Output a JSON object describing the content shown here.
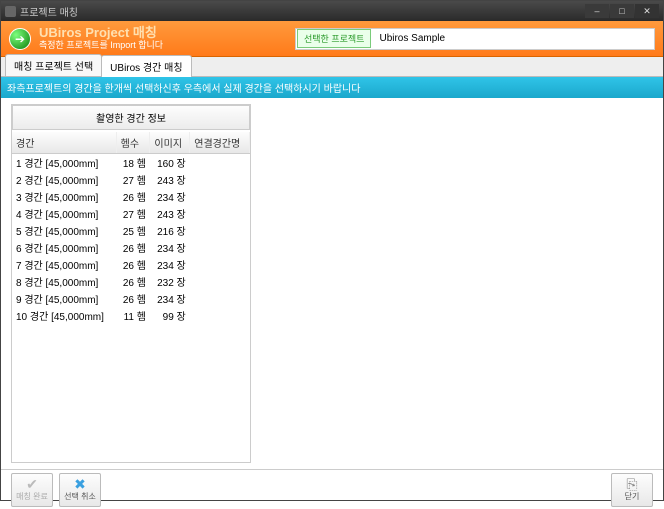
{
  "window": {
    "title": "프로젝트 매칭"
  },
  "banner": {
    "title": "UBiros Project 매칭",
    "subtitle": "측정한 프로젝트를 Import 합니다"
  },
  "project": {
    "label": "선택한 프로젝트",
    "value": "Ubiros Sample"
  },
  "tabs": [
    {
      "label": "매칭 프로젝트 선택",
      "active": false
    },
    {
      "label": "UBiros 경간 매칭",
      "active": true
    }
  ],
  "infobar": "좌측프로젝트의 경간을 한개씩 선택하신후 우측에서 실제 경간을 선택하시기 바랍니다",
  "left": {
    "header": "촬영한 경간 정보",
    "columns": [
      "경간",
      "헴수",
      "이미지",
      "연결경간명"
    ],
    "rows": [
      {
        "span": "1 경간 [45,000mm]",
        "hem": "18 헴",
        "img": "160 장",
        "link": ""
      },
      {
        "span": "2 경간 [45,000mm]",
        "hem": "27 헴",
        "img": "243 장",
        "link": ""
      },
      {
        "span": "3 경간 [45,000mm]",
        "hem": "26 헴",
        "img": "234 장",
        "link": ""
      },
      {
        "span": "4 경간 [45,000mm]",
        "hem": "27 헴",
        "img": "243 장",
        "link": ""
      },
      {
        "span": "5 경간 [45,000mm]",
        "hem": "25 헴",
        "img": "216 장",
        "link": ""
      },
      {
        "span": "6 경간 [45,000mm]",
        "hem": "26 헴",
        "img": "234 장",
        "link": ""
      },
      {
        "span": "7 경간 [45,000mm]",
        "hem": "26 헴",
        "img": "234 장",
        "link": ""
      },
      {
        "span": "8 경간 [45,000mm]",
        "hem": "26 헴",
        "img": "232 장",
        "link": ""
      },
      {
        "span": "9 경간 [45,000mm]",
        "hem": "26 헴",
        "img": "234 장",
        "link": ""
      },
      {
        "span": "10 경간 [45,000mm]",
        "hem": "11 헴",
        "img": "99 장",
        "link": ""
      }
    ]
  },
  "footer": {
    "done": "매칭 완료",
    "cancel": "선택 취소",
    "close": "닫기"
  }
}
